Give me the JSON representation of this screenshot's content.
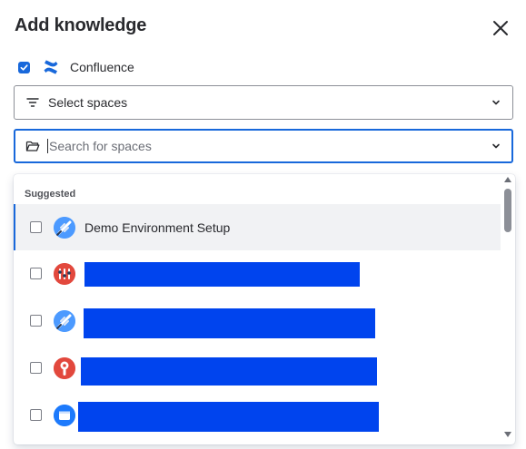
{
  "dialog": {
    "title": "Add knowledge",
    "close_icon": "close-icon"
  },
  "source": {
    "checked": true,
    "icon": "confluence-logo",
    "label": "Confluence",
    "color": "#1868db"
  },
  "spaces_select": {
    "icon": "filter-lines-icon",
    "label": "Select spaces",
    "chevron": "chevron-down-icon"
  },
  "search": {
    "icon": "folder-icon",
    "value": "",
    "placeholder": "Search for spaces",
    "chevron": "chevron-down-icon"
  },
  "dropdown": {
    "group_label": "Suggested",
    "options": [
      {
        "label": "Demo Environment Setup",
        "avatar": "rocket-avatar",
        "avatar_color": "#4c9aff",
        "redacted": false,
        "active": true
      },
      {
        "label": "",
        "avatar": "tools-avatar",
        "avatar_color": "#e2483d",
        "redacted": true,
        "active": false
      },
      {
        "label": "",
        "avatar": "rocket-avatar",
        "avatar_color": "#4c9aff",
        "redacted": true,
        "active": false
      },
      {
        "label": "",
        "avatar": "wrench-avatar",
        "avatar_color": "#e2483d",
        "redacted": true,
        "active": false
      },
      {
        "label": "",
        "avatar": "window-avatar",
        "avatar_color": "#1d7afc",
        "redacted": true,
        "active": false
      }
    ]
  },
  "colors": {
    "accent": "#1868db",
    "redaction": "#0044ee",
    "active_row_bg": "#f1f2f4"
  }
}
